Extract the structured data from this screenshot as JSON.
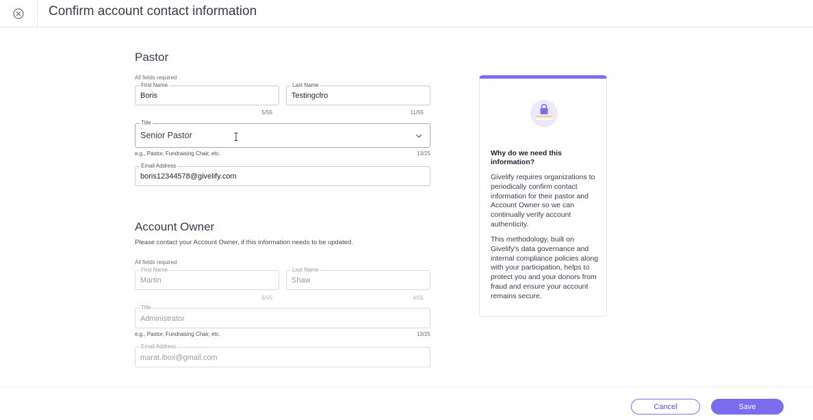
{
  "header": {
    "title": "Confirm account contact information",
    "close_icon": "close-circle-icon"
  },
  "pastor": {
    "heading": "Pastor",
    "required_note": "All fields required",
    "first_name": {
      "label": "First Name",
      "value": "Boris",
      "counter": "5/55"
    },
    "last_name": {
      "label": "Last Name",
      "value": "Testingcfro",
      "counter": "11/55"
    },
    "title": {
      "label": "Title",
      "value": "Senior Pastor",
      "helper": "e.g., Pastor, Fundraising Chair, etc.",
      "counter": "13/25"
    },
    "email": {
      "label": "Email Address",
      "value": "boris12344578@givelify.com"
    }
  },
  "account_owner": {
    "heading": "Account Owner",
    "description": "Please contact your Account Owner, if this information needs to be updated.",
    "required_note": "All fields required",
    "first_name": {
      "label": "First Name",
      "value": "Martin",
      "counter": "6/55"
    },
    "last_name": {
      "label": "Last Name",
      "value": "Shaw",
      "counter": "4/55"
    },
    "title": {
      "label": "Title",
      "value": "Administrator",
      "helper": "e.g., Pastor, Fundraising Chair, etc.",
      "counter": "13/25"
    },
    "email": {
      "label": "Email Address",
      "value": "marat.ibox@gmail.com"
    }
  },
  "info_card": {
    "icon": "lock-icon",
    "heading": "Why do we need this information?",
    "paragraph1": "Givelify requires organizations to periodically confirm contact information for their pastor and Account Owner so we can continually verify account authenticity.",
    "paragraph2": "This methodology, built on Givelify's data governance and internal compliance policies along with your participation, helps to protect you and your donors from fraud and ensure your account remains secure."
  },
  "footer": {
    "cancel_label": "Cancel",
    "save_label": "Save"
  },
  "colors": {
    "accent": "#7b6cf0",
    "accent_light": "#ece8fd",
    "border": "#c9c9d3"
  }
}
